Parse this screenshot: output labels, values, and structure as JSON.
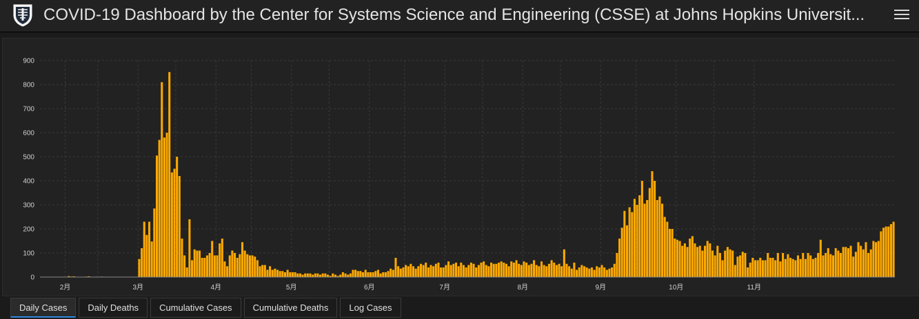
{
  "header": {
    "title": "COVID-19 Dashboard by the Center for Systems Science and Engineering (CSSE) at Johns Hopkins Universit...",
    "logo_icon": "university-shield-icon",
    "menu_icon": "hamburger-menu-icon"
  },
  "colors": {
    "bar": "#ffaa00",
    "grid": "#3a3a3a",
    "axis_text": "#cfcfcf",
    "background": "#222222",
    "tab_active_accent": "#2f8ae0"
  },
  "tabs": [
    {
      "label": "Daily Cases",
      "active": true
    },
    {
      "label": "Daily Deaths",
      "active": false
    },
    {
      "label": "Cumulative Cases",
      "active": false
    },
    {
      "label": "Cumulative Deaths",
      "active": false
    },
    {
      "label": "Log Cases",
      "active": false
    }
  ],
  "chart_data": {
    "type": "bar",
    "title": "",
    "xlabel": "",
    "ylabel": "",
    "ylim": [
      0,
      900
    ],
    "y_ticks": [
      0,
      100,
      200,
      300,
      400,
      500,
      600,
      700,
      800,
      900
    ],
    "x_tick_labels": [
      "2月",
      "3月",
      "4月",
      "5月",
      "6月",
      "7月",
      "8月",
      "9月",
      "10月",
      "11月"
    ],
    "x_start": "1月22日",
    "grid": true,
    "series": [
      {
        "values": [
          0,
          0,
          0,
          0,
          0,
          0,
          0,
          0,
          0,
          0,
          0,
          4,
          2,
          3,
          0,
          0,
          0,
          0,
          2,
          3,
          1,
          0,
          0,
          0,
          2,
          0,
          0,
          0,
          0,
          0,
          0,
          0,
          0,
          0,
          0,
          0,
          0,
          0,
          0,
          75,
          120,
          230,
          175,
          230,
          148,
          285,
          505,
          570,
          810,
          580,
          600,
          852,
          435,
          450,
          500,
          420,
          160,
          90,
          40,
          240,
          70,
          115,
          110,
          110,
          80,
          80,
          90,
          100,
          150,
          90,
          90,
          140,
          160,
          65,
          45,
          90,
          110,
          100,
          80,
          95,
          145,
          110,
          95,
          90,
          90,
          85,
          70,
          45,
          50,
          50,
          30,
          45,
          30,
          35,
          30,
          25,
          25,
          20,
          30,
          20,
          20,
          20,
          15,
          15,
          10,
          15,
          15,
          15,
          10,
          15,
          15,
          10,
          15,
          15,
          10,
          5,
          15,
          10,
          5,
          10,
          20,
          15,
          10,
          15,
          30,
          30,
          25,
          25,
          20,
          30,
          20,
          20,
          20,
          25,
          30,
          15,
          20,
          20,
          25,
          35,
          30,
          80,
          45,
          35,
          40,
          50,
          45,
          55,
          45,
          35,
          45,
          55,
          50,
          60,
          40,
          50,
          45,
          55,
          60,
          40,
          40,
          50,
          65,
          50,
          55,
          60,
          45,
          60,
          50,
          40,
          50,
          60,
          55,
          40,
          50,
          60,
          65,
          50,
          45,
          60,
          55,
          55,
          60,
          65,
          60,
          55,
          45,
          65,
          60,
          70,
          55,
          50,
          65,
          60,
          50,
          55,
          70,
          50,
          45,
          65,
          50,
          45,
          55,
          70,
          60,
          50,
          55,
          45,
          115,
          55,
          45,
          35,
          60,
          30,
          40,
          50,
          45,
          40,
          35,
          40,
          30,
          45,
          40,
          50,
          40,
          30,
          35,
          40,
          55,
          100,
          160,
          205,
          275,
          215,
          290,
          270,
          325,
          300,
          340,
          400,
          305,
          320,
          370,
          440,
          400,
          320,
          335,
          305,
          250,
          230,
          200,
          200,
          160,
          155,
          150,
          130,
          140,
          125,
          160,
          170,
          140,
          125,
          130,
          110,
          130,
          150,
          140,
          110,
          90,
          130,
          100,
          70,
          110,
          125,
          115,
          110,
          50,
          85,
          90,
          105,
          100,
          40,
          60,
          80,
          70,
          70,
          80,
          70,
          70,
          100,
          80,
          80,
          70,
          100,
          65,
          100,
          75,
          95,
          80,
          75,
          70,
          90,
          75,
          100,
          75,
          100,
          90,
          75,
          80,
          100,
          155,
          90,
          100,
          120,
          95,
          90,
          120,
          110,
          100,
          125,
          125,
          120,
          130,
          85,
          105,
          145,
          130,
          115,
          145,
          100,
          115,
          150,
          145,
          150,
          190,
          205,
          210,
          210,
          220,
          230
        ]
      }
    ]
  }
}
